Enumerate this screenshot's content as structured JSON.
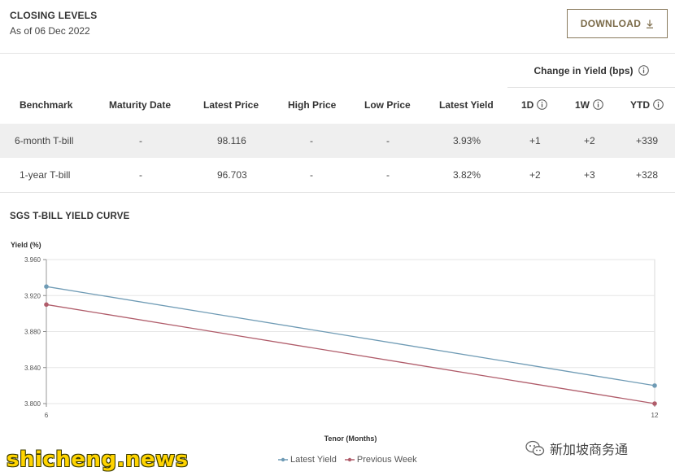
{
  "header": {
    "title": "CLOSING LEVELS",
    "as_of": "As of 06 Dec 2022",
    "download_label": "DOWNLOAD"
  },
  "table": {
    "group_header": "Change in Yield (bps)",
    "columns": [
      "Benchmark",
      "Maturity Date",
      "Latest Price",
      "High Price",
      "Low Price",
      "Latest Yield",
      "1D",
      "1W",
      "YTD"
    ],
    "rows": [
      {
        "benchmark": "6-month T-bill",
        "maturity": "-",
        "latest_price": "98.116",
        "high": "-",
        "low": "-",
        "latest_yield": "3.93%",
        "d1": "+1",
        "w1": "+2",
        "ytd": "+339"
      },
      {
        "benchmark": "1-year T-bill",
        "maturity": "-",
        "latest_price": "96.703",
        "high": "-",
        "low": "-",
        "latest_yield": "3.82%",
        "d1": "+2",
        "w1": "+3",
        "ytd": "+328"
      }
    ]
  },
  "chart_title": "SGS T-BILL YIELD CURVE",
  "chart_data": {
    "type": "line",
    "xlabel": "Tenor (Months)",
    "ylabel": "Yield (%)",
    "x": [
      6,
      12
    ],
    "xticks": [
      "6",
      "12"
    ],
    "ylim": [
      3.8,
      3.96
    ],
    "yticks": [
      "3.960",
      "3.920",
      "3.880",
      "3.840",
      "3.800"
    ],
    "grid": true,
    "legend_position": "bottom-center",
    "series": [
      {
        "name": "Latest Yield",
        "values": [
          3.93,
          3.82
        ],
        "color": "#6f9bb5"
      },
      {
        "name": "Previous Week",
        "values": [
          3.91,
          3.8
        ],
        "color": "#b05c6a"
      }
    ]
  },
  "watermarks": {
    "left": "shicheng.news",
    "right": "新加坡商务通"
  },
  "colors": {
    "accent": "#7a6a48",
    "row_alt": "#efefef",
    "latest": "#6f9bb5",
    "previous": "#b05c6a"
  }
}
